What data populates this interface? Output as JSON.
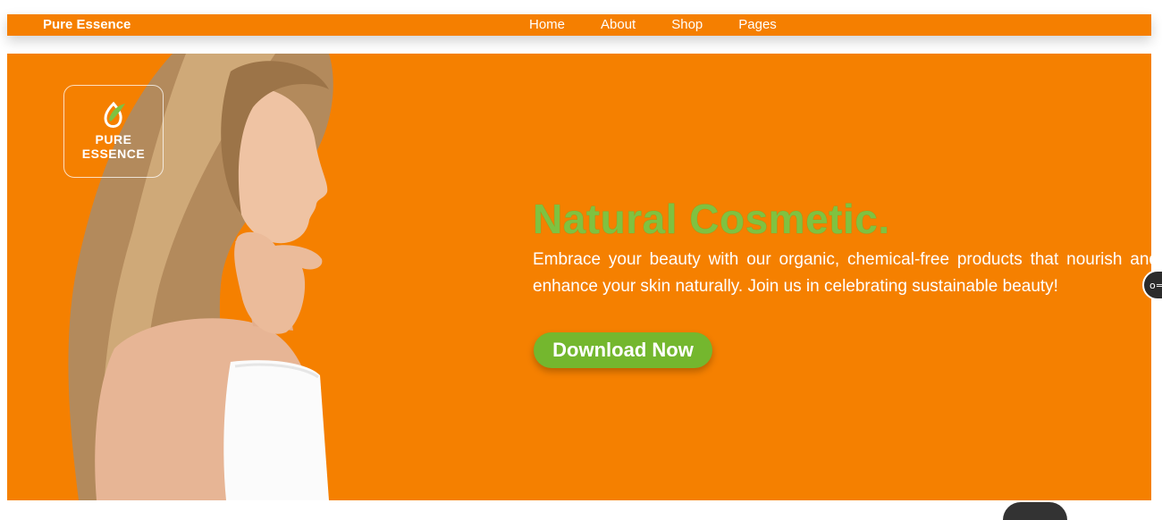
{
  "navbar": {
    "brand": "Pure Essence",
    "links": [
      "Home",
      "About",
      "Shop",
      "Pages"
    ]
  },
  "hero": {
    "logo_line1": "PURE",
    "logo_line2": "ESSENCE",
    "title": "Natural Cosmetic.",
    "description": "Embrace your beauty with our organic, chemical-free products that nourish and enhance your skin naturally. Join us in celebrating sustainable beauty!",
    "cta_label": "Download Now"
  },
  "colors": {
    "accent_orange": "#f57f00",
    "brand_green": "#7fc241",
    "button_green": "#74b72e"
  },
  "icons": {
    "logo": "leaf-drop-icon",
    "side_widget": "key-icon"
  }
}
